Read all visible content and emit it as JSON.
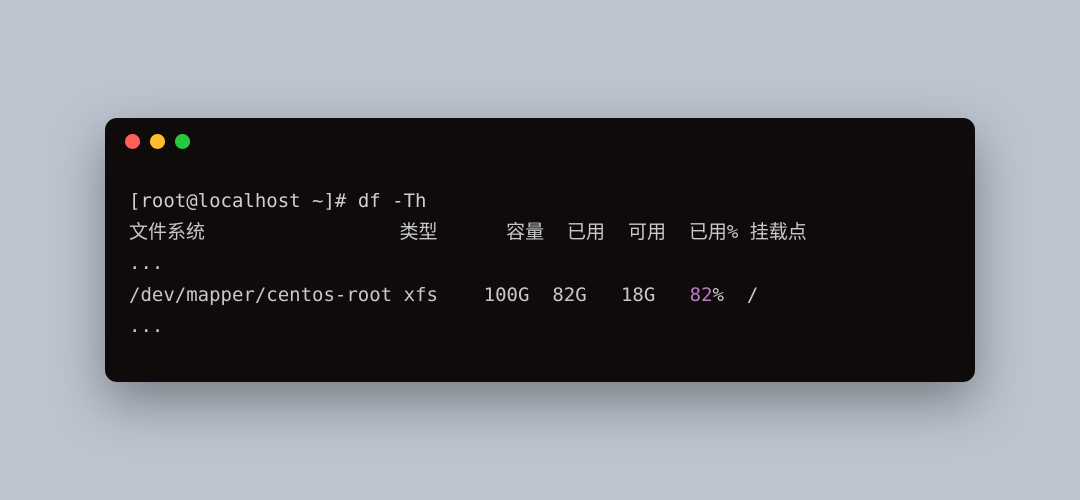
{
  "window": {
    "controls": [
      "close",
      "minimize",
      "maximize"
    ]
  },
  "prompt": {
    "user_host": "[root@localhost ~]",
    "separator": "#",
    "command": "df",
    "flag": "-Th"
  },
  "headers": {
    "filesystem": "文件系统",
    "type": "类型",
    "size": "容量",
    "used": "已用",
    "avail": "可用",
    "use_pct": "已用%",
    "mount": "挂载点"
  },
  "ellipsis_before": "...",
  "row": {
    "filesystem": "/dev/mapper/centos-root",
    "type": "xfs",
    "size": "100G",
    "used": "82G",
    "avail": "18G",
    "use_pct_num": "82",
    "use_pct_sym": "%",
    "mount": "/"
  },
  "ellipsis_after": "..."
}
